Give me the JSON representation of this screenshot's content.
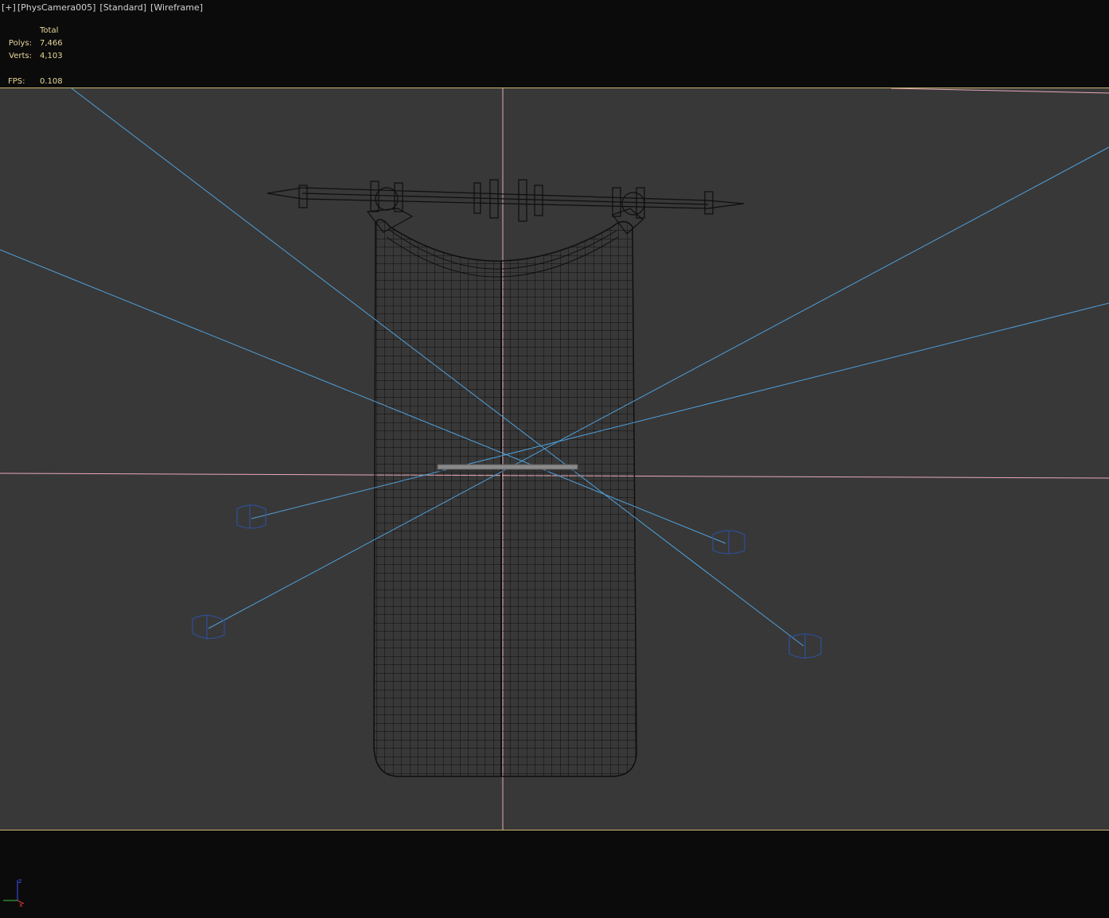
{
  "viewport": {
    "label_parts": [
      {
        "id": "plus",
        "text": "[+]"
      },
      {
        "id": "camera",
        "text": "[PhysCamera005]"
      },
      {
        "id": "shading-standard",
        "text": "[Standard]"
      },
      {
        "id": "shading-mode",
        "text": "[Wireframe]"
      }
    ]
  },
  "stats": {
    "header": "Total",
    "polys_label": "Polys:",
    "polys_value": "7,466",
    "verts_label": "Verts:",
    "verts_value": "4,103",
    "fps_label": "FPS:",
    "fps_value": "0.108"
  },
  "axis_tripod": {
    "z_label": "z",
    "x_label": "x",
    "y_label": "y"
  },
  "colors": {
    "background": "#0b0b0b",
    "viewport_fill": "#383838",
    "safe_frame": "#c8b46a",
    "stats_text": "#e7d89a",
    "light_ray": "#4f9fd9",
    "light_icon": "#2e4f9a",
    "pink_guide": "#e8a8b8",
    "wire": "#0e0e0e"
  },
  "icons": [
    "light-target-icon",
    "axis-tripod-icon"
  ]
}
